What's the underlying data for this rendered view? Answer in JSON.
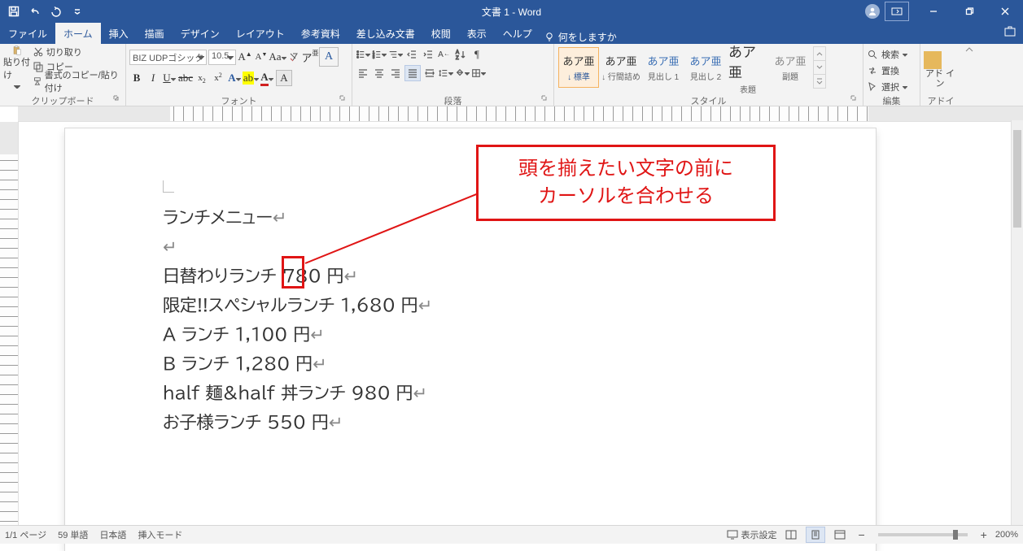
{
  "titlebar": {
    "title": "文書 1  -  Word"
  },
  "tabs": {
    "file": "ファイル",
    "items": [
      "ホーム",
      "挿入",
      "描画",
      "デザイン",
      "レイアウト",
      "参考資料",
      "差し込み文書",
      "校閲",
      "表示",
      "ヘルプ"
    ],
    "active_index": 0,
    "tellme": "何をしますか"
  },
  "ribbon": {
    "clipboard": {
      "paste": "貼り付け",
      "cut": "切り取り",
      "copy": "コピー",
      "format_painter": "書式のコピー/貼り付け",
      "label": "クリップボード"
    },
    "font": {
      "name": "BIZ UDPゴシック",
      "size": "10.5",
      "label": "フォント"
    },
    "paragraph": {
      "label": "段落"
    },
    "styles": {
      "label": "スタイル",
      "items": [
        {
          "preview": "あア亜",
          "name": "↓ 標準"
        },
        {
          "preview": "あア亜",
          "name": "↓ 行間詰め"
        },
        {
          "preview": "あア亜",
          "name": "見出し 1"
        },
        {
          "preview": "あア亜",
          "name": "見出し 2"
        },
        {
          "preview": "あア亜",
          "name": "表題"
        },
        {
          "preview": "あア亜",
          "name": "副題"
        }
      ]
    },
    "editing": {
      "find": "検索",
      "replace": "置換",
      "select": "選択",
      "label": "編集"
    },
    "addin": {
      "text": "アド\nイン",
      "label": "アドイン"
    }
  },
  "document": {
    "lines": [
      "ランチメニュー",
      "",
      "日替わりランチ 780 円",
      "限定!!スペシャルランチ 1,680 円",
      "A ランチ 1,100 円",
      "B ランチ 1,280 円",
      "half 麺&half 丼ランチ 980 円",
      "お子様ランチ 550 円"
    ]
  },
  "callout": {
    "line1": "頭を揃えたい文字の前に",
    "line2": "カーソルを合わせる"
  },
  "status": {
    "page": "1/1 ページ",
    "words": "59 単語",
    "lang": "日本語",
    "mode": "挿入モード",
    "disp": "表示設定",
    "zoom": "200%"
  }
}
